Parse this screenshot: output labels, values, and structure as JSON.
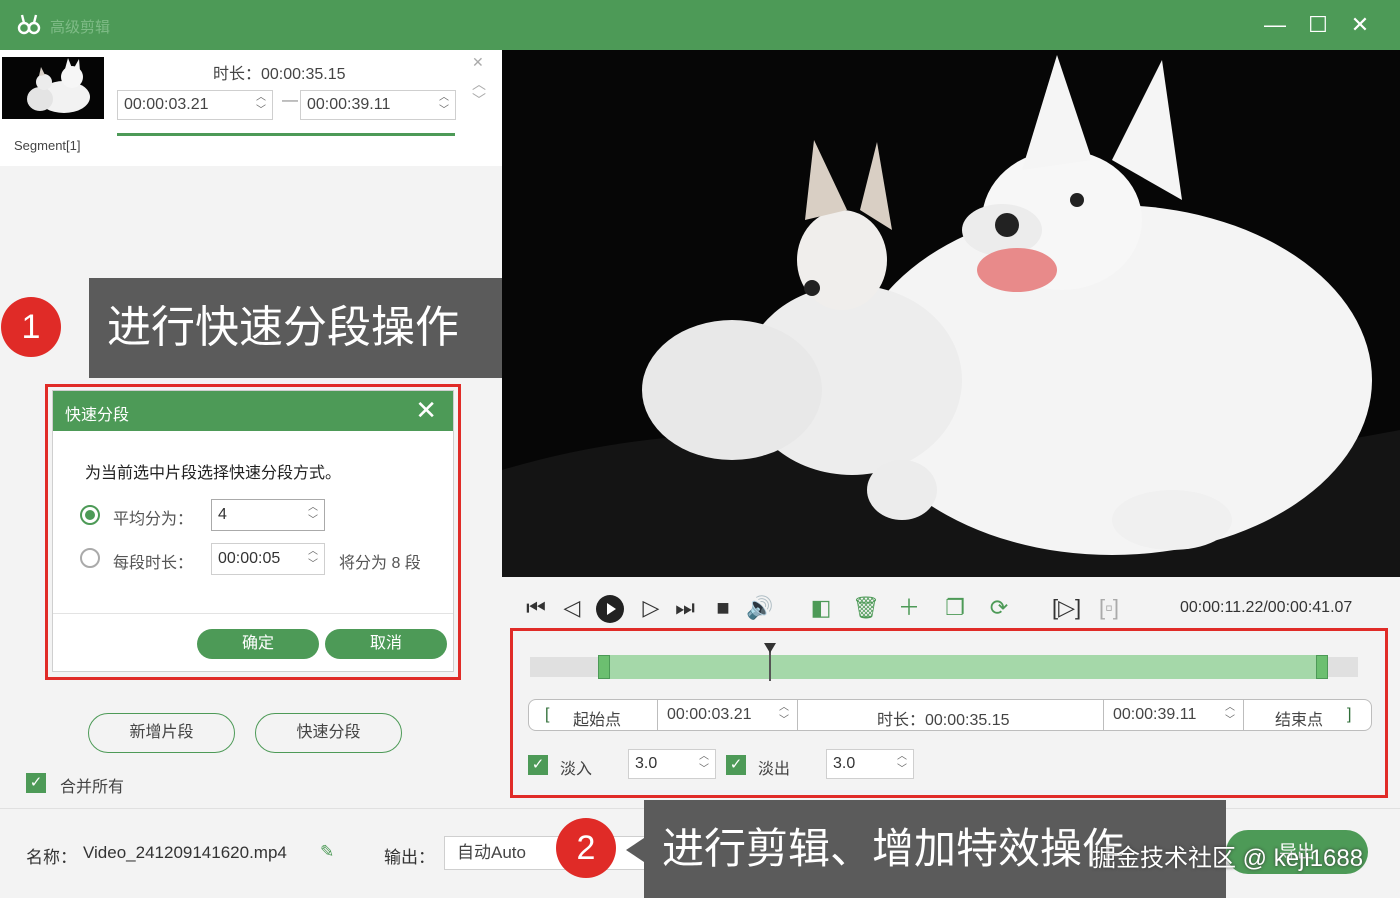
{
  "window": {
    "logo_glyph": "ờ",
    "title": "高级剪辑",
    "minimize_glyph": "—",
    "maximize_glyph": "☐",
    "close_glyph": "✕"
  },
  "segment_card": {
    "label": "Segment[1]",
    "duration_label": "时长：00:00:35.15",
    "start_time": "00:00:03.21",
    "end_time": "00:00:39.11",
    "dash": "—"
  },
  "annotations": {
    "step1_number": "1",
    "step1_text": "进行快速分段操作",
    "step2_number": "2",
    "step2_text": "进行剪辑、增加特效操作"
  },
  "quick_split_dialog": {
    "title": "快速分段",
    "description": "为当前选中片段选择快速分段方式。",
    "option_even_label": "平均分为：",
    "option_even_value": "4",
    "option_duration_label": "每段时长：",
    "option_duration_value": "00:00:05",
    "split_info": "将分为 8 段",
    "confirm_label": "确定",
    "cancel_label": "取消",
    "selected_option": "even"
  },
  "left_actions": {
    "add_segment_label": "新增片段",
    "quick_split_label": "快速分段",
    "merge_all_label": "合并所有",
    "merge_all_checked": true
  },
  "player": {
    "time_readout": "00:00:11.22/00:00:41.07",
    "icons": [
      "skip-start-icon",
      "step-back-icon",
      "play-icon",
      "step-forward-icon",
      "skip-end-icon",
      "stop-icon",
      "volume-icon",
      "split-icon",
      "delete-icon",
      "add-icon",
      "copy-icon",
      "rotate-icon",
      "crop-play-icon",
      "crop-icon"
    ],
    "playhead_fraction": 0.28
  },
  "edit_panel": {
    "start_label": "起始点",
    "start_value": "00:00:03.21",
    "duration_label": "时长：00:00:35.15",
    "end_value": "00:00:39.11",
    "end_label": "结束点",
    "fade_in_label": "淡入",
    "fade_in_value": "3.0",
    "fade_out_label": "淡出",
    "fade_out_value": "3.0",
    "fade_in_checked": true,
    "fade_out_checked": true
  },
  "bottom_bar": {
    "name_label": "名称：",
    "file_name": "Video_241209141620.mp4",
    "output_label": "输出：",
    "output_value": "自动Auto",
    "export_label": "导出"
  },
  "watermark": "掘金技术社区 @ keji1688",
  "colors": {
    "accent": "#4d9a57",
    "annotation_red": "#e02b27",
    "annotation_box": "#5b5b5b"
  }
}
